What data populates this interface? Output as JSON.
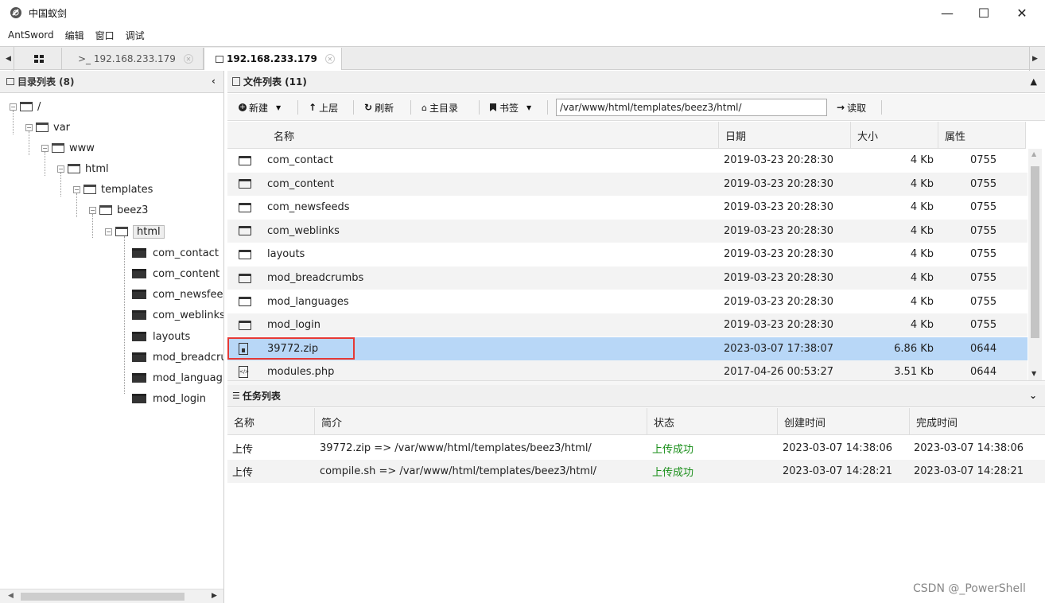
{
  "window": {
    "title": "中国蚁剑",
    "minimize": "—",
    "maximize": "☐",
    "close": "✕"
  },
  "menu": [
    "AntSword",
    "编辑",
    "窗口",
    "调试"
  ],
  "tabs": {
    "home_icon": "grid-icon",
    "terminal": ">_ 192.168.233.179",
    "file": "192.168.233.179",
    "close_glyph": "✕"
  },
  "dir_panel": {
    "title": "目录列表 (8)",
    "collapse": "‹",
    "tree": [
      {
        "label": "/",
        "level": 0,
        "type": "expanded"
      },
      {
        "label": "var",
        "level": 1,
        "type": "expanded"
      },
      {
        "label": "www",
        "level": 2,
        "type": "expanded"
      },
      {
        "label": "html",
        "level": 3,
        "type": "expanded"
      },
      {
        "label": "templates",
        "level": 4,
        "type": "expanded"
      },
      {
        "label": "beez3",
        "level": 5,
        "type": "expanded"
      },
      {
        "label": "html",
        "level": 6,
        "type": "selected"
      },
      {
        "label": "com_contact",
        "level": 7,
        "type": "leaf"
      },
      {
        "label": "com_content",
        "level": 7,
        "type": "leaf"
      },
      {
        "label": "com_newsfee",
        "level": 7,
        "type": "leaf"
      },
      {
        "label": "com_weblinks",
        "level": 7,
        "type": "leaf"
      },
      {
        "label": "layouts",
        "level": 7,
        "type": "leaf"
      },
      {
        "label": "mod_breadcru",
        "level": 7,
        "type": "leaf"
      },
      {
        "label": "mod_languag",
        "level": 7,
        "type": "leaf"
      },
      {
        "label": "mod_login",
        "level": 7,
        "type": "leaf"
      }
    ]
  },
  "file_panel": {
    "title": "文件列表 (11)",
    "toolbar": {
      "new": "新建",
      "up": "上层",
      "refresh": "刷新",
      "home": "主目录",
      "bookmark": "书签",
      "path": "/var/www/html/templates/beez3/html/",
      "read": "读取"
    },
    "columns": [
      "名称",
      "日期",
      "大小",
      "属性"
    ],
    "rows": [
      {
        "icon": "folder",
        "name": "com_contact",
        "date": "2019-03-23 20:28:30",
        "size": "4 Kb",
        "attr": "0755"
      },
      {
        "icon": "folder",
        "name": "com_content",
        "date": "2019-03-23 20:28:30",
        "size": "4 Kb",
        "attr": "0755"
      },
      {
        "icon": "folder",
        "name": "com_newsfeeds",
        "date": "2019-03-23 20:28:30",
        "size": "4 Kb",
        "attr": "0755"
      },
      {
        "icon": "folder",
        "name": "com_weblinks",
        "date": "2019-03-23 20:28:30",
        "size": "4 Kb",
        "attr": "0755"
      },
      {
        "icon": "folder",
        "name": "layouts",
        "date": "2019-03-23 20:28:30",
        "size": "4 Kb",
        "attr": "0755"
      },
      {
        "icon": "folder",
        "name": "mod_breadcrumbs",
        "date": "2019-03-23 20:28:30",
        "size": "4 Kb",
        "attr": "0755"
      },
      {
        "icon": "folder",
        "name": "mod_languages",
        "date": "2019-03-23 20:28:30",
        "size": "4 Kb",
        "attr": "0755"
      },
      {
        "icon": "folder",
        "name": "mod_login",
        "date": "2019-03-23 20:28:30",
        "size": "4 Kb",
        "attr": "0755"
      },
      {
        "icon": "zip",
        "name": "39772.zip",
        "date": "2023-03-07 17:38:07",
        "size": "6.86 Kb",
        "attr": "0644",
        "selected": true
      },
      {
        "icon": "php",
        "name": "modules.php",
        "date": "2017-04-26 00:53:27",
        "size": "3.51 Kb",
        "attr": "0644"
      }
    ]
  },
  "task_panel": {
    "title": "任务列表",
    "columns": [
      "名称",
      "简介",
      "状态",
      "创建时间",
      "完成时间"
    ],
    "rows": [
      {
        "name": "上传",
        "desc": "39772.zip => /var/www/html/templates/beez3/html/",
        "status": "上传成功",
        "created": "2023-03-07 14:38:06",
        "finished": "2023-03-07 14:38:06"
      },
      {
        "name": "上传",
        "desc": "compile.sh => /var/www/html/templates/beez3/html/",
        "status": "上传成功",
        "created": "2023-03-07 14:28:21",
        "finished": "2023-03-07 14:28:21"
      }
    ]
  },
  "watermark": "CSDN @_PowerShell",
  "colors": {
    "selected_row": "#b8d7f7",
    "highlight_box": "#e53935",
    "success": "#1a8f1a"
  }
}
